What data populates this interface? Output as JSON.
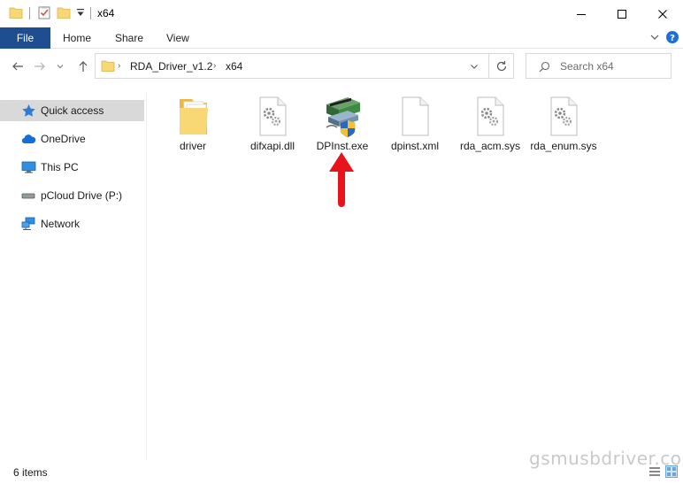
{
  "window": {
    "title": "x64"
  },
  "ribbon": {
    "tabs": [
      {
        "label": "File"
      },
      {
        "label": "Home"
      },
      {
        "label": "Share"
      },
      {
        "label": "View"
      }
    ]
  },
  "address": {
    "breadcrumb": [
      "RDA_Driver_v1.2",
      "x64"
    ]
  },
  "search": {
    "placeholder": "Search x64"
  },
  "sidebar": {
    "items": [
      {
        "label": "Quick access",
        "icon": "star-icon"
      },
      {
        "label": "OneDrive",
        "icon": "cloud-icon"
      },
      {
        "label": "This PC",
        "icon": "computer-icon"
      },
      {
        "label": "pCloud Drive (P:)",
        "icon": "drive-icon"
      },
      {
        "label": "Network",
        "icon": "network-icon"
      }
    ]
  },
  "files": [
    {
      "name": "driver",
      "icon": "folder-icon"
    },
    {
      "name": "difxapi.dll",
      "icon": "settings-file-icon"
    },
    {
      "name": "DPInst.exe",
      "icon": "installer-icon"
    },
    {
      "name": "dpinst.xml",
      "icon": "blank-file-icon"
    },
    {
      "name": "rda_acm.sys",
      "icon": "settings-file-icon"
    },
    {
      "name": "rda_enum.sys",
      "icon": "settings-file-icon"
    }
  ],
  "status": {
    "item_count": "6 items"
  },
  "watermark": "gsmusbdriver.com",
  "colors": {
    "file_tab": "#1e4d90",
    "folder": "#f8d775",
    "selection": "#d9d9d9",
    "arrow": "#e8131b"
  }
}
